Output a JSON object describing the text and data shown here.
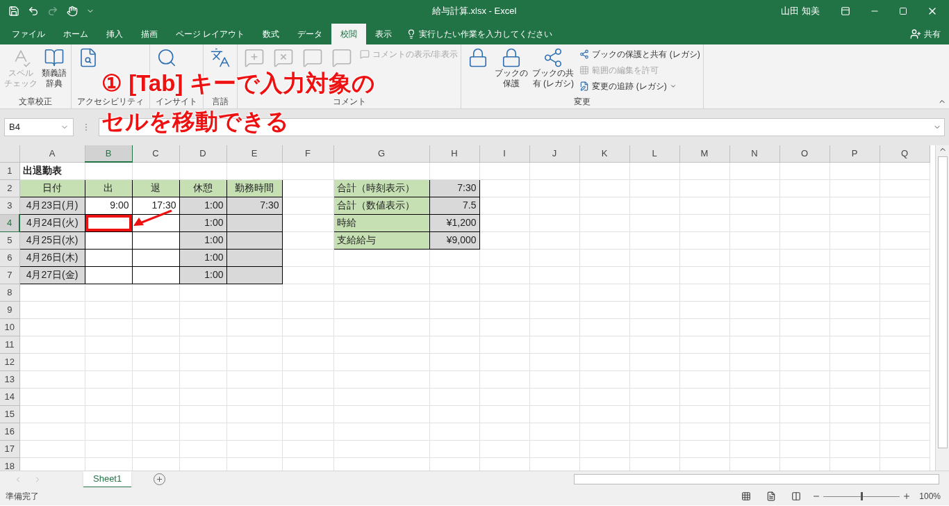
{
  "window": {
    "title": "給与計算.xlsx  -  Excel",
    "user": "山田 知美"
  },
  "ribbon_tabs": [
    {
      "label": "ファイル",
      "selected": false
    },
    {
      "label": "ホーム",
      "selected": false
    },
    {
      "label": "挿入",
      "selected": false
    },
    {
      "label": "描画",
      "selected": false
    },
    {
      "label": "ページ レイアウト",
      "selected": false
    },
    {
      "label": "数式",
      "selected": false
    },
    {
      "label": "データ",
      "selected": false
    },
    {
      "label": "校閲",
      "selected": true
    },
    {
      "label": "表示",
      "selected": false
    }
  ],
  "tell_me": {
    "placeholder": "実行したい作業を入力してください"
  },
  "share": "共有",
  "ribbon_groups": [
    {
      "label": "文章校正",
      "buttons": [
        {
          "kind": "large",
          "lines": [
            "スペル",
            "チェック"
          ],
          "disabled": true
        },
        {
          "kind": "large",
          "lines": [
            "類義語",
            "辞典"
          ],
          "disabled": false
        }
      ]
    },
    {
      "label": "アクセシビリティ",
      "buttons": [
        {
          "kind": "large",
          "disabled": false
        }
      ]
    },
    {
      "label": "インサイト",
      "buttons": [
        {
          "kind": "large",
          "disabled": false
        }
      ]
    },
    {
      "label": "言語",
      "buttons": [
        {
          "kind": "large",
          "disabled": false
        }
      ]
    },
    {
      "label": "コメント",
      "buttons": [
        {
          "kind": "large",
          "disabled": true
        },
        {
          "kind": "large",
          "disabled": true
        },
        {
          "kind": "large",
          "disabled": true
        },
        {
          "kind": "large",
          "disabled": true
        },
        {
          "kind": "small",
          "lines": [
            "コメントの表示/非表示"
          ],
          "disabled": true
        }
      ]
    },
    {
      "label": "変更",
      "buttons": [
        {
          "kind": "large",
          "disabled": false
        },
        {
          "kind": "large",
          "lines": [
            "ブックの",
            "保護"
          ],
          "disabled": false
        },
        {
          "kind": "large",
          "lines": [
            "ブックの共",
            "有 (レガシ)"
          ],
          "disabled": false
        },
        {
          "kind": "small",
          "lines": [
            "ブックの保護と共有 (レガシ)"
          ],
          "disabled": false
        },
        {
          "kind": "small",
          "lines": [
            "範囲の編集を許可"
          ],
          "disabled": true
        },
        {
          "kind": "small",
          "lines": [
            "変更の追跡 (レガシ)"
          ],
          "disabled": false,
          "dropdown": true
        }
      ]
    }
  ],
  "name_box": "B4",
  "grid": {
    "columns": [
      {
        "label": "A",
        "selected": false
      },
      {
        "label": "B",
        "selected": true
      },
      {
        "label": "C",
        "selected": false
      },
      {
        "label": "D",
        "selected": false
      },
      {
        "label": "E",
        "selected": false
      },
      {
        "label": "F",
        "selected": false
      },
      {
        "label": "G",
        "selected": false
      },
      {
        "label": "H",
        "selected": false
      },
      {
        "label": "I",
        "selected": false
      },
      {
        "label": "J",
        "selected": false
      },
      {
        "label": "K",
        "selected": false
      },
      {
        "label": "L",
        "selected": false
      },
      {
        "label": "M",
        "selected": false
      },
      {
        "label": "N",
        "selected": false
      },
      {
        "label": "O",
        "selected": false
      },
      {
        "label": "P",
        "selected": false
      },
      {
        "label": "Q",
        "selected": false
      }
    ],
    "rows": [
      {
        "label": "1",
        "selected": false,
        "cells": [
          {
            "kind": "title",
            "text": "出退勤表"
          }
        ]
      },
      {
        "label": "2",
        "selected": false,
        "cells": [
          {
            "kind": "header",
            "text": "日付"
          },
          {
            "kind": "header",
            "text": "出"
          },
          {
            "kind": "header",
            "text": "退"
          },
          {
            "kind": "header",
            "text": "休憩"
          },
          {
            "kind": "header",
            "text": "勤務時間"
          },
          {
            "kind": "empty"
          },
          {
            "kind": "label",
            "text": "合計（時刻表示）"
          },
          {
            "kind": "value",
            "text": "7:30"
          }
        ]
      },
      {
        "label": "3",
        "selected": false,
        "cells": [
          {
            "kind": "date",
            "text": "4月23日(月)"
          },
          {
            "kind": "input",
            "text": "9:00"
          },
          {
            "kind": "input",
            "text": "17:30"
          },
          {
            "kind": "value",
            "text": "1:00"
          },
          {
            "kind": "value",
            "text": "7:30"
          },
          {
            "kind": "empty"
          },
          {
            "kind": "label",
            "text": "合計（数値表示）"
          },
          {
            "kind": "value",
            "text": "7.5"
          }
        ]
      },
      {
        "label": "4",
        "selected": true,
        "cells": [
          {
            "kind": "date",
            "text": "4月24日(火)"
          },
          {
            "kind": "input",
            "selected": true
          },
          {
            "kind": "input"
          },
          {
            "kind": "value",
            "text": "1:00"
          },
          {
            "kind": "value"
          },
          {
            "kind": "empty"
          },
          {
            "kind": "label",
            "text": "時給"
          },
          {
            "kind": "value",
            "text": "¥1,200 "
          }
        ]
      },
      {
        "label": "5",
        "selected": false,
        "cells": [
          {
            "kind": "date",
            "text": "4月25日(水)"
          },
          {
            "kind": "input"
          },
          {
            "kind": "input"
          },
          {
            "kind": "value",
            "text": "1:00"
          },
          {
            "kind": "value"
          },
          {
            "kind": "empty"
          },
          {
            "kind": "label",
            "text": "支給給与"
          },
          {
            "kind": "value",
            "text": "¥9,000 "
          }
        ]
      },
      {
        "label": "6",
        "selected": false,
        "cells": [
          {
            "kind": "date",
            "text": "4月26日(木)"
          },
          {
            "kind": "input"
          },
          {
            "kind": "input"
          },
          {
            "kind": "value",
            "text": "1:00"
          },
          {
            "kind": "value"
          }
        ]
      },
      {
        "label": "7",
        "selected": false,
        "cells": [
          {
            "kind": "date",
            "text": "4月27日(金)"
          },
          {
            "kind": "input"
          },
          {
            "kind": "input"
          },
          {
            "kind": "value",
            "text": "1:00"
          },
          {
            "kind": "value"
          }
        ]
      },
      {
        "label": "8",
        "selected": false,
        "cells": []
      },
      {
        "label": "9",
        "selected": false,
        "cells": []
      },
      {
        "label": "10",
        "selected": false,
        "cells": []
      },
      {
        "label": "11",
        "selected": false,
        "cells": []
      },
      {
        "label": "12",
        "selected": false,
        "cells": []
      },
      {
        "label": "13",
        "selected": false,
        "cells": []
      },
      {
        "label": "14",
        "selected": false,
        "cells": []
      },
      {
        "label": "15",
        "selected": false,
        "cells": []
      },
      {
        "label": "16",
        "selected": false,
        "cells": []
      },
      {
        "label": "17",
        "selected": false,
        "cells": []
      },
      {
        "label": "18",
        "selected": false,
        "cells": []
      }
    ]
  },
  "sheets": [
    {
      "label": "Sheet1",
      "selected": true
    }
  ],
  "status_bar": {
    "text": "準備完了",
    "zoom": "100%",
    "level": 0.5
  },
  "annotation": {
    "lines": [
      "① [Tab] キーで入力対象の",
      "セルを移動できる"
    ]
  }
}
